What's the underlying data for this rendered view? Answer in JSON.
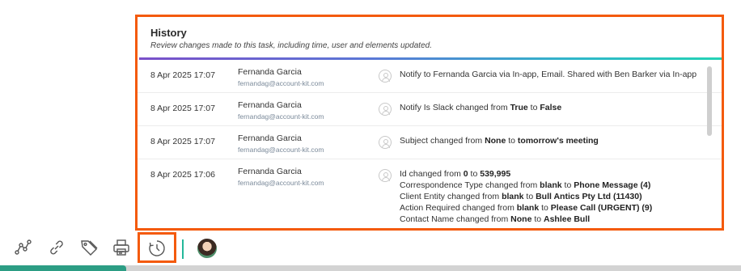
{
  "history": {
    "title": "History",
    "subtitle": "Review changes made to this task, including time, user and elements updated.",
    "rows": [
      {
        "date": "8 Apr 2025 17:07",
        "user_name": "Fernanda Garcia",
        "user_email": "fernandag@account-kit.com",
        "lines": [
          [
            {
              "t": "Notify to Fernanda Garcia via In-app, Email. Shared with Ben Barker via In-app",
              "b": false
            }
          ]
        ]
      },
      {
        "date": "8 Apr 2025 17:07",
        "user_name": "Fernanda Garcia",
        "user_email": "fernandag@account-kit.com",
        "lines": [
          [
            {
              "t": "Notify Is Slack changed from ",
              "b": false
            },
            {
              "t": "True",
              "b": true
            },
            {
              "t": " to ",
              "b": false
            },
            {
              "t": "False",
              "b": true
            }
          ]
        ]
      },
      {
        "date": "8 Apr 2025 17:07",
        "user_name": "Fernanda Garcia",
        "user_email": "fernandag@account-kit.com",
        "lines": [
          [
            {
              "t": "Subject changed from ",
              "b": false
            },
            {
              "t": "None",
              "b": true
            },
            {
              "t": " to ",
              "b": false
            },
            {
              "t": "tomorrow's meeting",
              "b": true
            }
          ]
        ]
      },
      {
        "date": "8 Apr 2025 17:06",
        "user_name": "Fernanda Garcia",
        "user_email": "fernandag@account-kit.com",
        "lines": [
          [
            {
              "t": "Id changed from ",
              "b": false
            },
            {
              "t": "0",
              "b": true
            },
            {
              "t": " to ",
              "b": false
            },
            {
              "t": "539,995",
              "b": true
            }
          ],
          [
            {
              "t": "Correspondence Type changed from ",
              "b": false
            },
            {
              "t": "blank",
              "b": true
            },
            {
              "t": " to ",
              "b": false
            },
            {
              "t": "Phone Message (4)",
              "b": true
            }
          ],
          [
            {
              "t": "Client Entity changed from ",
              "b": false
            },
            {
              "t": "blank",
              "b": true
            },
            {
              "t": " to ",
              "b": false
            },
            {
              "t": "Bull Antics Pty Ltd (11430)",
              "b": true
            }
          ],
          [
            {
              "t": "Action Required changed from ",
              "b": false
            },
            {
              "t": "blank",
              "b": true
            },
            {
              "t": " to ",
              "b": false
            },
            {
              "t": "Please Call (URGENT) (9)",
              "b": true
            }
          ],
          [
            {
              "t": "Contact Name changed from ",
              "b": false
            },
            {
              "t": "None",
              "b": true
            },
            {
              "t": " to ",
              "b": false
            },
            {
              "t": "Ashlee Bull",
              "b": true
            }
          ]
        ]
      }
    ]
  },
  "toolbar": {
    "icons": [
      "workflow-icon",
      "link-icon",
      "tag-icon",
      "print-icon",
      "history-clock-icon"
    ],
    "active_icon": "history-clock-icon",
    "accent_color": "#f45a0c",
    "divider_color": "#23b89a"
  },
  "colors": {
    "highlight": "#f45a0c",
    "progress": "#2c9d84"
  },
  "progress": {
    "fraction": 0.17
  }
}
